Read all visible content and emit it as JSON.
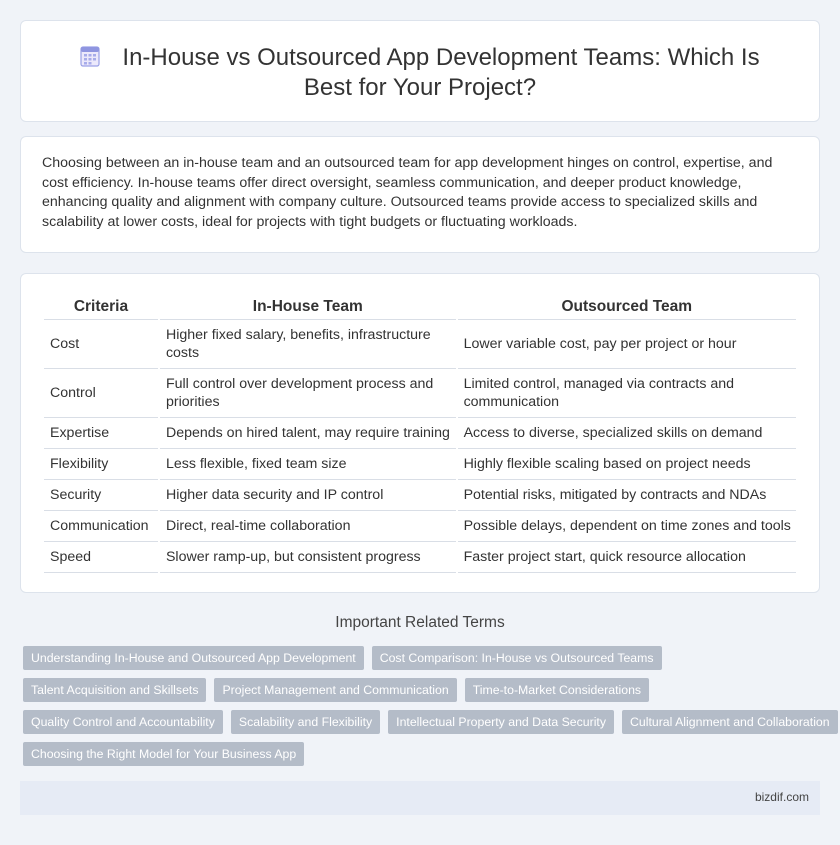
{
  "header": {
    "title": "In-House vs Outsourced App Development Teams: Which Is Best for Your Project?",
    "icon": "document-calendar-icon"
  },
  "intro": {
    "text": "Choosing between an in-house team and an outsourced team for app development hinges on control, expertise, and cost efficiency. In-house teams offer direct oversight, seamless communication, and deeper product knowledge, enhancing quality and alignment with company culture. Outsourced teams provide access to specialized skills and scalability at lower costs, ideal for projects with tight budgets or fluctuating workloads."
  },
  "table": {
    "headers": [
      "Criteria",
      "In-House Team",
      "Outsourced Team"
    ],
    "rows": [
      [
        "Cost",
        "Higher fixed salary, benefits, infrastructure costs",
        "Lower variable cost, pay per project or hour"
      ],
      [
        "Control",
        "Full control over development process and priorities",
        "Limited control, managed via contracts and communication"
      ],
      [
        "Expertise",
        "Depends on hired talent, may require training",
        "Access to diverse, specialized skills on demand"
      ],
      [
        "Flexibility",
        "Less flexible, fixed team size",
        "Highly flexible scaling based on project needs"
      ],
      [
        "Security",
        "Higher data security and IP control",
        "Potential risks, mitigated by contracts and NDAs"
      ],
      [
        "Communication",
        "Direct, real-time collaboration",
        "Possible delays, dependent on time zones and tools"
      ],
      [
        "Speed",
        "Slower ramp-up, but consistent progress",
        "Faster project start, quick resource allocation"
      ]
    ]
  },
  "related": {
    "title": "Important Related Terms",
    "tags": [
      "Understanding In-House and Outsourced App Development",
      "Cost Comparison: In-House vs Outsourced Teams",
      "Talent Acquisition and Skillsets",
      "Project Management and Communication",
      "Time-to-Market Considerations",
      "Quality Control and Accountability",
      "Scalability and Flexibility",
      "Intellectual Property and Data Security",
      "Cultural Alignment and Collaboration",
      "Choosing the Right Model for Your Business App"
    ]
  },
  "footer": {
    "site": "bizdif.com"
  },
  "colors": {
    "background": "#f0f3f8",
    "card": "#ffffff",
    "tag": "#b4bcc8",
    "footer_bar": "#e6ebf5",
    "icon_accent": "#7b83d6"
  }
}
